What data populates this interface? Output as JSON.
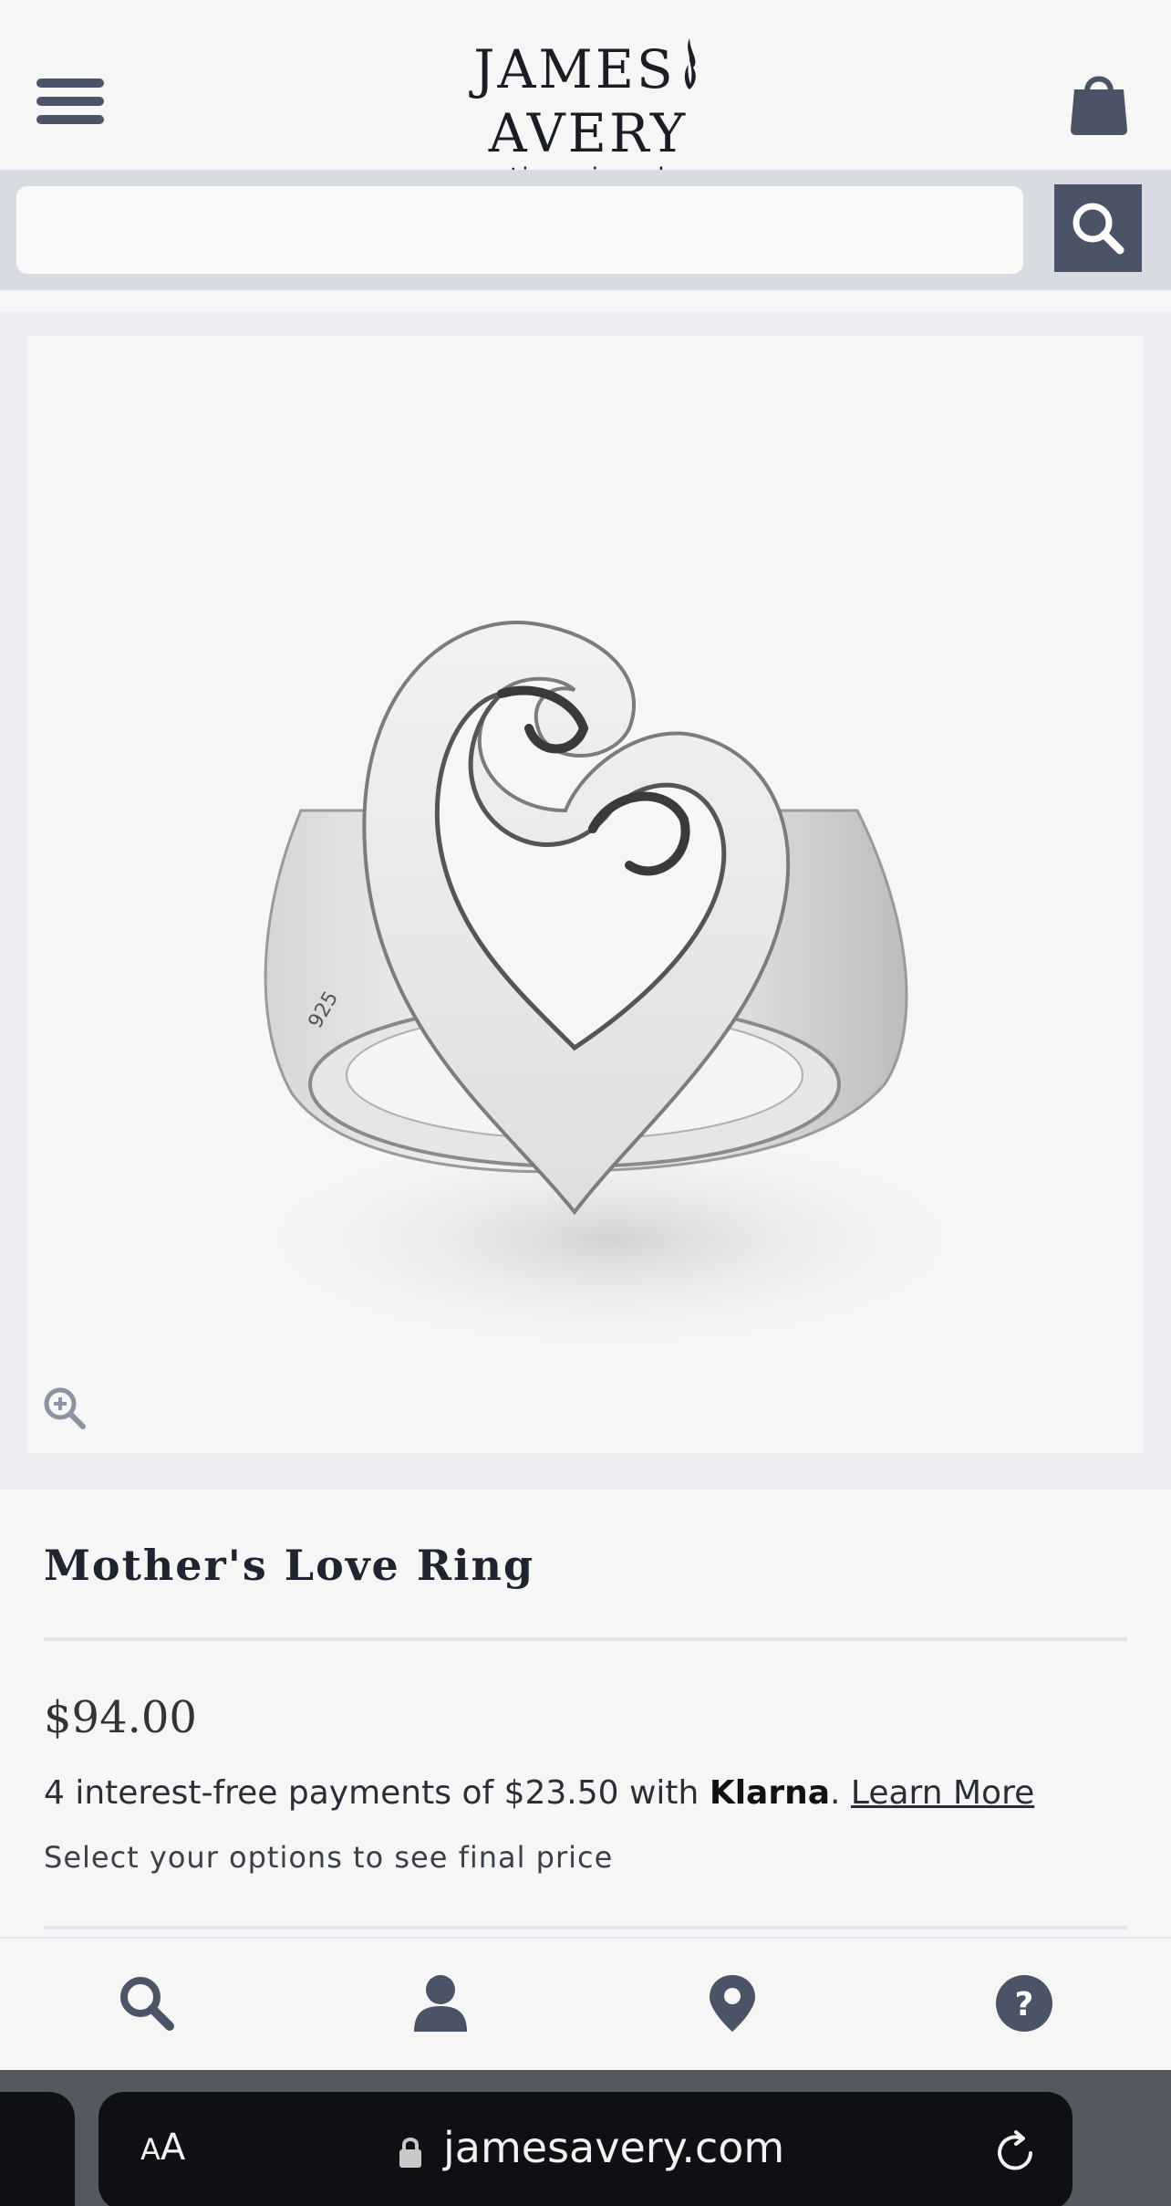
{
  "header": {
    "logo_main_left": "JAMES",
    "logo_main_right": "AVERY",
    "logo_sub": "artisan jewelry"
  },
  "search": {
    "value": "",
    "placeholder": ""
  },
  "product": {
    "title": "Mother's Love Ring",
    "price": "$94.00",
    "klarna_prefix": "4 interest-free payments of $23.50 with ",
    "klarna_brand": "Klarna",
    "klarna_suffix": ". ",
    "learn_more": "Learn More",
    "options_note": "Select your options to see final price",
    "image_stamp": "925"
  },
  "bottom_nav": {
    "items": [
      "search-icon",
      "account-icon",
      "location-pin-icon",
      "help-icon"
    ]
  },
  "browser": {
    "aa_large": "A",
    "aa_small": "A",
    "url": "jamesavery.com"
  },
  "colors": {
    "accent": "#4b5466",
    "background": "#f6f6f6",
    "search_strip": "#d8dbe2"
  }
}
